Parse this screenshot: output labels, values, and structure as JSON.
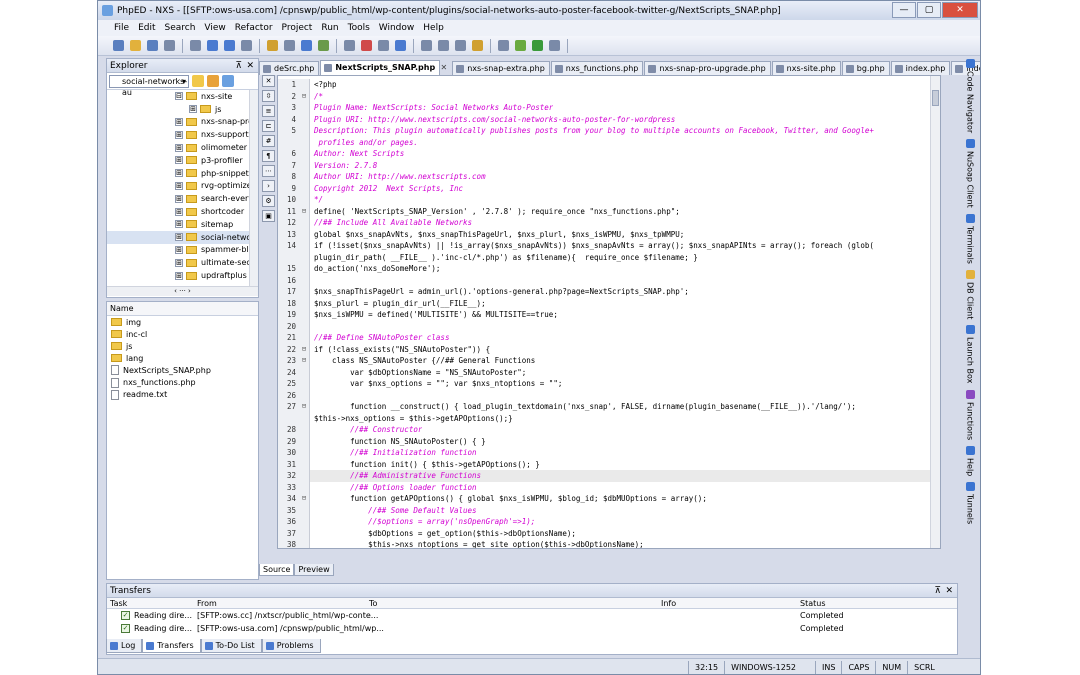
{
  "window": {
    "title": "PhpED - NXS - [[SFTP:ows-usa.com] /cpnswp/public_html/wp-content/plugins/social-networks-auto-poster-facebook-twitter-g/NextScripts_SNAP.php]"
  },
  "menu": [
    "File",
    "Edit",
    "Search",
    "View",
    "Refactor",
    "Project",
    "Run",
    "Tools",
    "Window",
    "Help"
  ],
  "explorer": {
    "title": "Explorer",
    "path": "social-networks-au",
    "tree": [
      {
        "label": "nxs-site",
        "exp": "⊟"
      },
      {
        "label": "js",
        "exp": "⊞"
      },
      {
        "label": "nxs-snap-pro",
        "exp": "⊞"
      },
      {
        "label": "nxs-support-",
        "exp": "⊞"
      },
      {
        "label": "olimometer",
        "exp": "⊞"
      },
      {
        "label": "p3-profiler",
        "exp": "⊞"
      },
      {
        "label": "php-snippets",
        "exp": "⊞"
      },
      {
        "label": "rvg-optimize-",
        "exp": "⊞"
      },
      {
        "label": "search-every",
        "exp": "⊞"
      },
      {
        "label": "shortcoder",
        "exp": "⊞"
      },
      {
        "label": "sitemap",
        "exp": "⊞"
      },
      {
        "label": "social-networ",
        "exp": "⊞"
      },
      {
        "label": "spammer-blo",
        "exp": "⊞"
      },
      {
        "label": "ultimate-secu",
        "exp": "⊞"
      },
      {
        "label": "updraftplus",
        "exp": "⊞"
      }
    ]
  },
  "files": {
    "header": "Name",
    "folders": [
      "img",
      "inc-cl",
      "js",
      "lang"
    ],
    "items": [
      "NextScripts_SNAP.php",
      "nxs_functions.php",
      "readme.txt"
    ]
  },
  "tabs": [
    "deSrc.php",
    "NextScripts_SNAP.php",
    "nxs-snap-extra.php",
    "nxs_functions.php",
    "nxs-snap-pro-upgrade.php",
    "nxs-site.php",
    "bg.php",
    "index.php",
    "index.tpl.php"
  ],
  "code": [
    {
      "n": "1",
      "t": "<?php",
      "c": false
    },
    {
      "n": "2",
      "t": "/*",
      "c": true
    },
    {
      "n": "3",
      "t": "Plugin Name: NextScripts: Social Networks Auto-Poster",
      "c": true
    },
    {
      "n": "4",
      "t": "Plugin URI: http://www.nextscripts.com/social-networks-auto-poster-for-wordpress",
      "c": true
    },
    {
      "n": "5",
      "t": "Description: This plugin automatically publishes posts from your blog to multiple accounts on Facebook, Twitter, and Google+",
      "c": true
    },
    {
      "n": "",
      "t": " profiles and/or pages.",
      "c": true
    },
    {
      "n": "6",
      "t": "Author: Next Scripts",
      "c": true
    },
    {
      "n": "7",
      "t": "Version: 2.7.8",
      "c": true
    },
    {
      "n": "8",
      "t": "Author URI: http://www.nextscripts.com",
      "c": true
    },
    {
      "n": "9",
      "t": "Copyright 2012  Next Scripts, Inc",
      "c": true
    },
    {
      "n": "10",
      "t": "*/",
      "c": true
    },
    {
      "n": "11",
      "t": "define( 'NextScripts_SNAP_Version' , '2.7.8' ); require_once \"nxs_functions.php\";",
      "c": false
    },
    {
      "n": "12",
      "t": "//## Include All Available Networks",
      "c": true
    },
    {
      "n": "13",
      "t": "global $nxs_snapAvNts, $nxs_snapThisPageUrl, $nxs_plurl, $nxs_isWPMU, $nxs_tpWMPU;",
      "c": false
    },
    {
      "n": "14",
      "t": "if (!isset($nxs_snapAvNts) || !is_array($nxs_snapAvNts)) $nxs_snapAvNts = array(); $nxs_snapAPINts = array(); foreach (glob(",
      "c": false
    },
    {
      "n": "",
      "t": "plugin_dir_path( __FILE__ ).'inc-cl/*.php') as $filename){  require_once $filename; }",
      "c": false
    },
    {
      "n": "15",
      "t": "do_action('nxs_doSomeMore');",
      "c": false
    },
    {
      "n": "16",
      "t": "",
      "c": false
    },
    {
      "n": "17",
      "t": "$nxs_snapThisPageUrl = admin_url().'options-general.php?page=NextScripts_SNAP.php';",
      "c": false
    },
    {
      "n": "18",
      "t": "$nxs_plurl = plugin_dir_url(__FILE__);",
      "c": false
    },
    {
      "n": "19",
      "t": "$nxs_isWPMU = defined('MULTISITE') && MULTISITE==true;",
      "c": false
    },
    {
      "n": "20",
      "t": "",
      "c": false
    },
    {
      "n": "21",
      "t": "//## Define SNAutoPoster class",
      "c": true
    },
    {
      "n": "22",
      "t": "if (!class_exists(\"NS_SNAutoPoster\")) {",
      "c": false
    },
    {
      "n": "23",
      "t": "    class NS_SNAutoPoster {//## General Functions",
      "c": false
    },
    {
      "n": "24",
      "t": "        var $dbOptionsName = \"NS_SNAutoPoster\";",
      "c": false
    },
    {
      "n": "25",
      "t": "        var $nxs_options = \"\"; var $nxs_ntoptions = \"\";",
      "c": false
    },
    {
      "n": "26",
      "t": "",
      "c": false
    },
    {
      "n": "27",
      "t": "        function __construct() { load_plugin_textdomain('nxs_snap', FALSE, dirname(plugin_basename(__FILE__)).'/lang/');",
      "c": false
    },
    {
      "n": "",
      "t": "$this->nxs_options = $this->getAPOptions();}",
      "c": false
    },
    {
      "n": "28",
      "t": "        //## Constructor",
      "c": true
    },
    {
      "n": "29",
      "t": "        function NS_SNAutoPoster() { }",
      "c": false
    },
    {
      "n": "30",
      "t": "        //## Initialization function",
      "c": true
    },
    {
      "n": "31",
      "t": "        function init() { $this->getAPOptions(); }",
      "c": false
    },
    {
      "n": "32",
      "t": "        //## Administrative Functions",
      "c": true
    },
    {
      "n": "33",
      "t": "        //## Options loader function",
      "c": true
    },
    {
      "n": "34",
      "t": "        function getAPOptions() { global $nxs_isWPMU, $blog_id; $dbMUOptions = array();",
      "c": false
    },
    {
      "n": "35",
      "t": "            //## Some Default Values",
      "c": true
    },
    {
      "n": "36",
      "t": "            //$options = array('nsOpenGraph'=>1);",
      "c": true
    },
    {
      "n": "37",
      "t": "            $dbOptions = get_option($this->dbOptionsName);",
      "c": false
    },
    {
      "n": "38",
      "t": "            $this->nxs_ntoptions = get_site_option($this->dbOptionsName);",
      "c": false
    }
  ],
  "editor_tabs": {
    "source": "Source",
    "preview": "Preview"
  },
  "right_panels": [
    "Code Navigator",
    "NuSoap Client",
    "Terminals",
    "DB Client",
    "Launch Box",
    "Functions",
    "Help",
    "Tunnels"
  ],
  "transfers": {
    "title": "Transfers",
    "columns": [
      "Task",
      "From",
      "To",
      "Info",
      "Status"
    ],
    "rows": [
      {
        "task": "Reading dire...",
        "from": "[SFTP:ows.cc] /nxtscr/public_html/wp-conte...",
        "to": "",
        "info": "",
        "status": "Completed"
      },
      {
        "task": "Reading dire...",
        "from": "[SFTP:ows-usa.com] /cpnswp/public_html/wp...",
        "to": "",
        "info": "",
        "status": "Completed"
      }
    ]
  },
  "bottom_tabs": [
    "Log",
    "Transfers",
    "To-Do List",
    "Problems"
  ],
  "status": {
    "position": "32:15",
    "encoding": "WINDOWS-1252",
    "ins": "INS",
    "caps": "CAPS",
    "num": "NUM",
    "scrl": "SCRL"
  }
}
